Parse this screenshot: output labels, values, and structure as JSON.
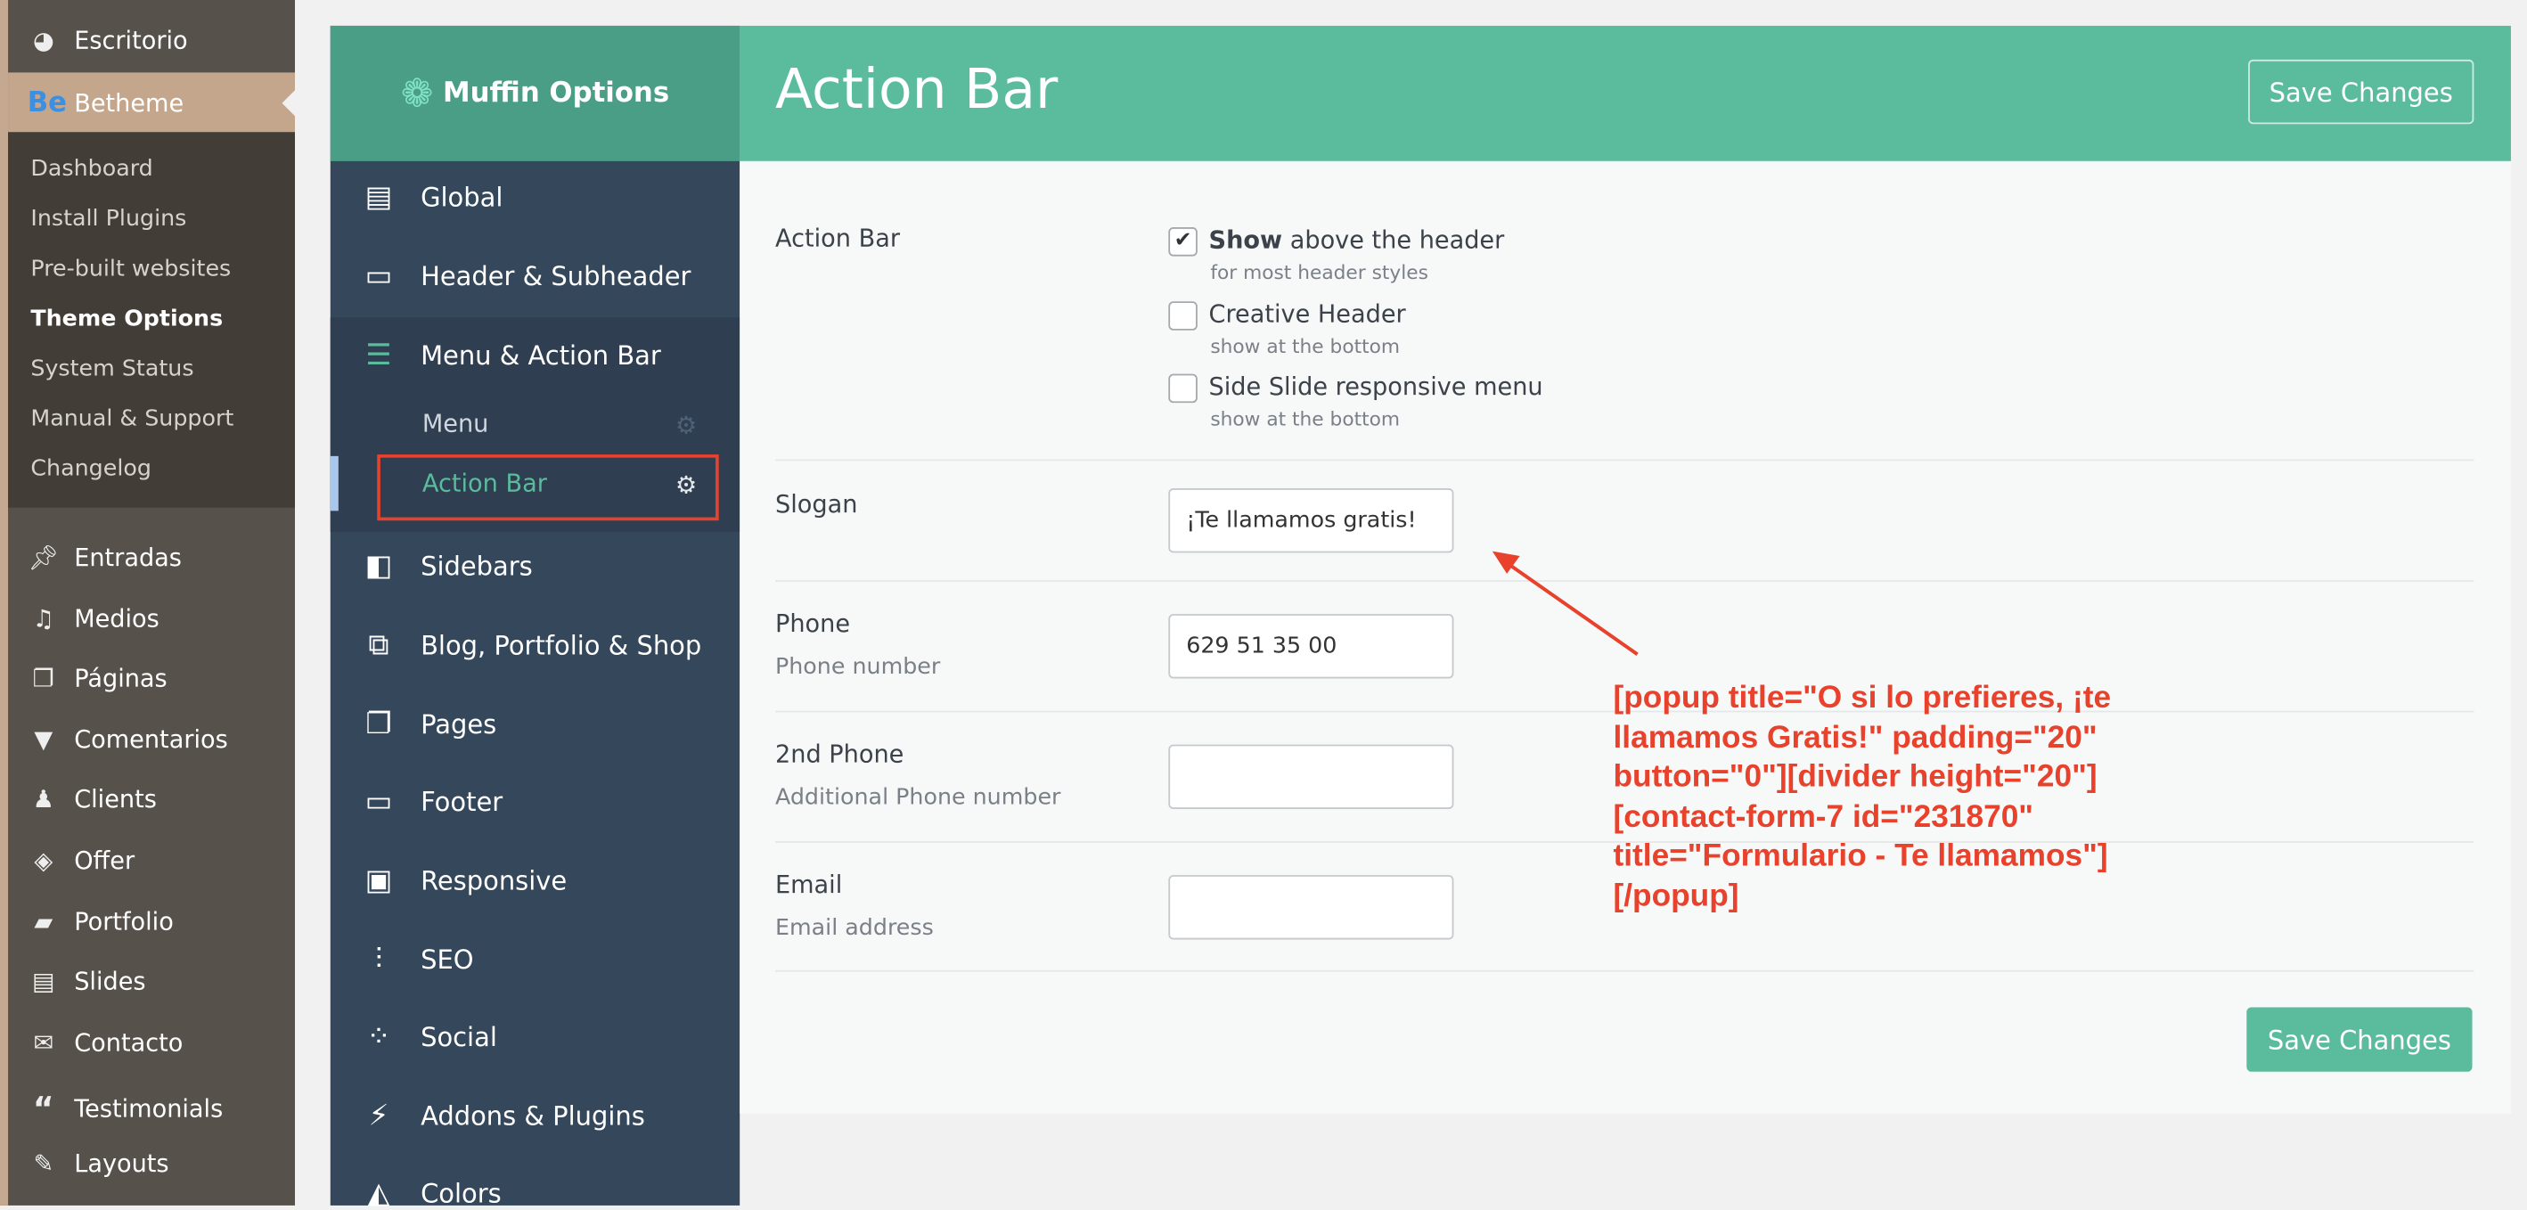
{
  "wp_menu": {
    "top": [
      {
        "label": "Escritorio",
        "icon": "dashboard-icon"
      }
    ],
    "active": {
      "label": "Betheme",
      "icon_text": "Be"
    },
    "submenu": [
      "Dashboard",
      "Install Plugins",
      "Pre-built websites",
      "Theme Options",
      "System Status",
      "Manual & Support",
      "Changelog"
    ],
    "current_sub": "Theme Options",
    "items": [
      {
        "label": "Entradas",
        "icon": "pin-icon"
      },
      {
        "label": "Medios",
        "icon": "media-icon"
      },
      {
        "label": "Páginas",
        "icon": "pages-icon"
      },
      {
        "label": "Comentarios",
        "icon": "comment-icon"
      },
      {
        "label": "Clients",
        "icon": "user-icon"
      },
      {
        "label": "Offer",
        "icon": "tag-icon"
      },
      {
        "label": "Portfolio",
        "icon": "folder-icon"
      },
      {
        "label": "Slides",
        "icon": "slides-icon"
      },
      {
        "label": "Contacto",
        "icon": "mail-icon"
      },
      {
        "label": "Testimonials",
        "icon": "quote-icon"
      },
      {
        "label": "Layouts",
        "icon": "pencil-icon"
      }
    ]
  },
  "muffin": {
    "logo": "Muffin Options",
    "nav": [
      {
        "label": "Global",
        "icon": "global-icon"
      },
      {
        "label": "Header & Subheader",
        "icon": "header-icon"
      },
      {
        "label": "Menu & Action Bar",
        "icon": "menu-icon"
      },
      {
        "label": "Sidebars",
        "icon": "sidebars-icon"
      },
      {
        "label": "Blog, Portfolio & Shop",
        "icon": "blog-icon"
      },
      {
        "label": "Pages",
        "icon": "pages-icon"
      },
      {
        "label": "Footer",
        "icon": "footer-icon"
      },
      {
        "label": "Responsive",
        "icon": "responsive-icon"
      },
      {
        "label": "SEO",
        "icon": "seo-icon"
      },
      {
        "label": "Social",
        "icon": "social-icon"
      },
      {
        "label": "Addons & Plugins",
        "icon": "plug-icon"
      },
      {
        "label": "Colors",
        "icon": "colors-icon"
      }
    ],
    "subnav": [
      {
        "label": "Menu"
      },
      {
        "label": "Action Bar",
        "active": true
      }
    ]
  },
  "page": {
    "title": "Action Bar",
    "save_label": "Save Changes",
    "fields": {
      "action_bar": {
        "label": "Action Bar",
        "options": [
          {
            "bold": "Show",
            "text": " above the header",
            "desc": "for most header styles",
            "checked": true
          },
          {
            "bold": "",
            "text": "Creative Header",
            "desc": "show at the bottom",
            "checked": false
          },
          {
            "bold": "",
            "text": "Side Slide responsive menu",
            "desc": "show at the bottom",
            "checked": false
          }
        ]
      },
      "slogan": {
        "label": "Slogan",
        "value": "¡Te llamamos gratis!"
      },
      "phone": {
        "label": "Phone",
        "desc": "Phone number",
        "value": "629 51 35 00"
      },
      "phone2": {
        "label": "2nd Phone",
        "desc": "Additional Phone number",
        "value": ""
      },
      "email": {
        "label": "Email",
        "desc": "Email address",
        "value": ""
      }
    }
  },
  "annotation": "[popup title=\"O si lo prefieres, ¡te llamamos Gratis!\" padding=\"20\" button=\"0\"][divider height=\"20\"][contact-form-7 id=\"231870\" title=\"Formulario - Te llamamos\"][/popup]",
  "colors": {
    "accent": "#5bbb9d",
    "nav": "#34475b",
    "annotation": "#e8412c",
    "wp_active": "#c4a68c"
  }
}
